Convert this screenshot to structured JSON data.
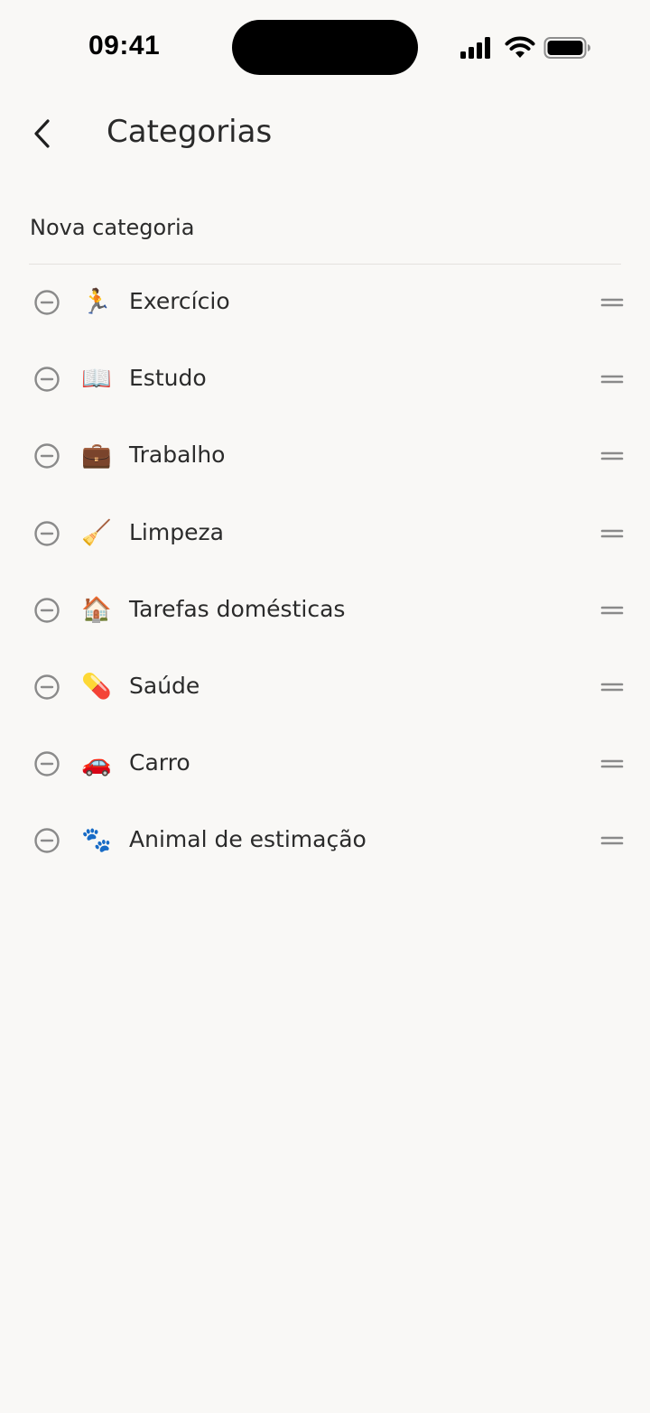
{
  "status_bar": {
    "time": "09:41"
  },
  "header": {
    "title": "Categorias",
    "back_icon": "chevron-left-icon"
  },
  "new_category": {
    "placeholder": "Nova categoria",
    "value": ""
  },
  "categories": [
    {
      "emoji": "🏃",
      "label": "Exercício"
    },
    {
      "emoji": "📖",
      "label": "Estudo"
    },
    {
      "emoji": "💼",
      "label": "Trabalho"
    },
    {
      "emoji": "🧹",
      "label": "Limpeza"
    },
    {
      "emoji": "🏠",
      "label": "Tarefas domésticas"
    },
    {
      "emoji": "💊",
      "label": "Saúde"
    },
    {
      "emoji": "🚗",
      "label": "Carro"
    },
    {
      "emoji": "🐾",
      "label": "Animal de estimação"
    }
  ],
  "icons": {
    "remove": "minus-circle-icon",
    "reorder": "drag-handle-icon"
  },
  "colors": {
    "background": "#f9f8f6",
    "text": "#2b2b2b",
    "icon_gray": "#8a8a8a",
    "divider": "#e4e2de"
  }
}
